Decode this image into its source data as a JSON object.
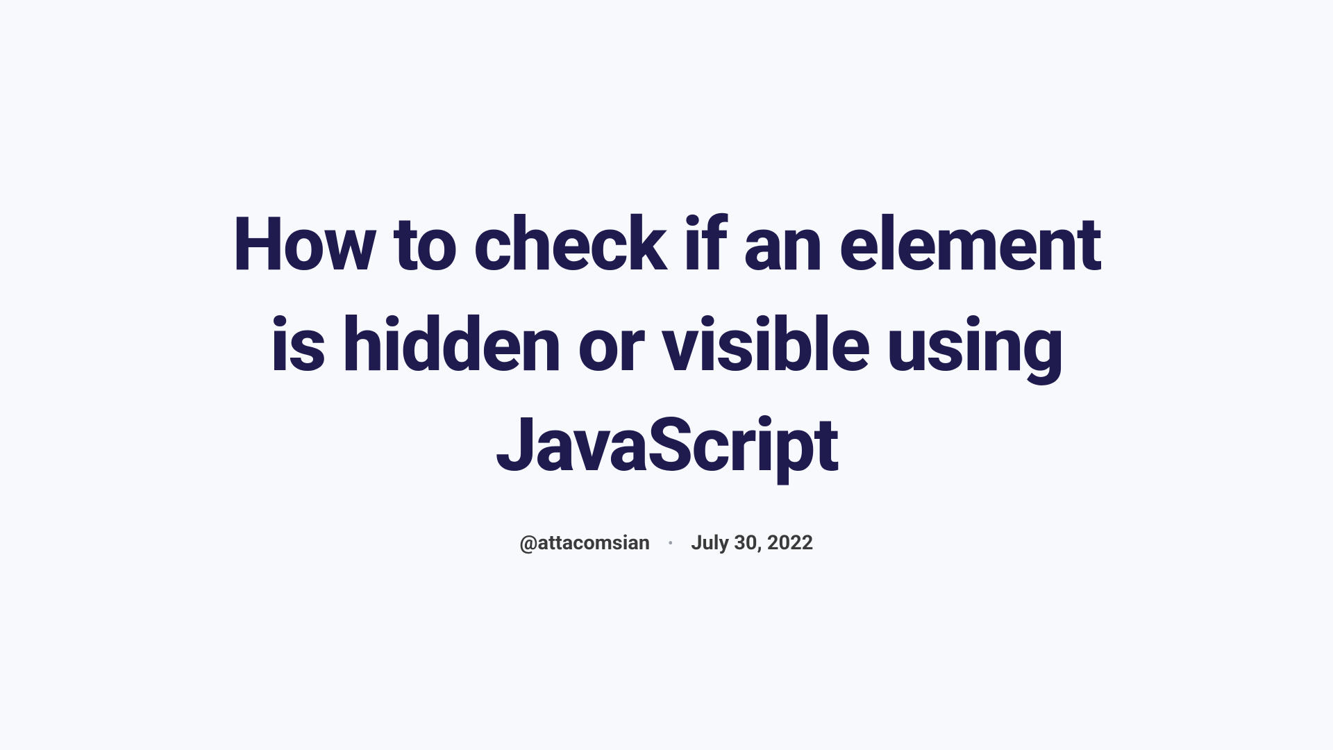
{
  "article": {
    "title": "How to check if an element is hidden or visible using JavaScript",
    "author_handle": "@attacomsian",
    "separator": "•",
    "publish_date": "July 30, 2022"
  }
}
